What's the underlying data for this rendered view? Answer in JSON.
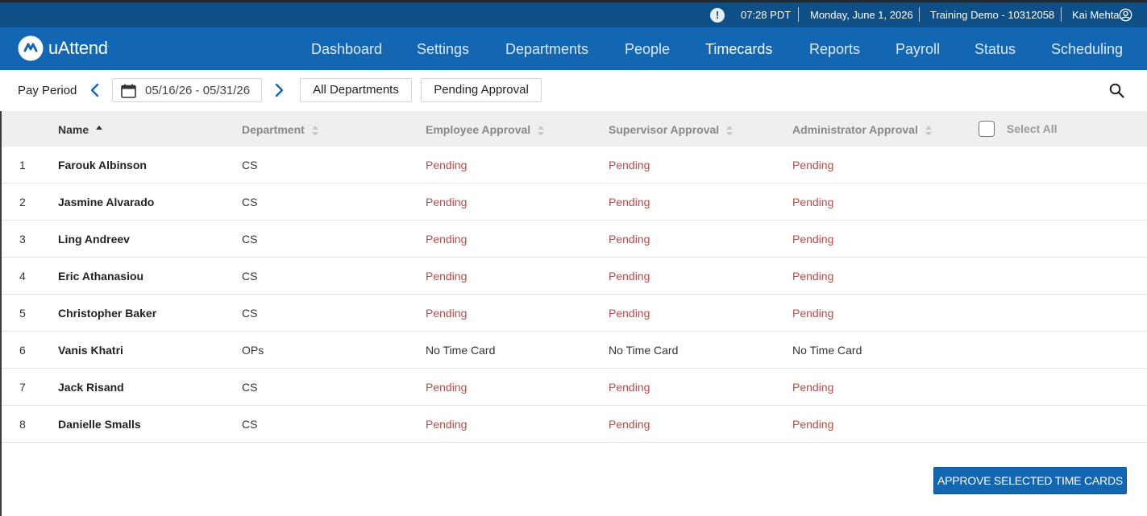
{
  "topbar": {
    "time": "07:28 PDT",
    "date": "Monday, June 1, 2026",
    "account": "Training Demo - 10312058",
    "user": "Kai Mehta",
    "alert_glyph": "!"
  },
  "brand": {
    "name": "uAttend",
    "trademark": "."
  },
  "nav": [
    {
      "label": "Dashboard"
    },
    {
      "label": "Settings"
    },
    {
      "label": "Departments"
    },
    {
      "label": "People"
    },
    {
      "label": "Timecards"
    },
    {
      "label": "Reports"
    },
    {
      "label": "Payroll"
    },
    {
      "label": "Status"
    },
    {
      "label": "Scheduling"
    }
  ],
  "active_nav": "Timecards",
  "toolbar": {
    "pay_period_label": "Pay Period",
    "date_range": "05/16/26 - 05/31/26",
    "department_filter": "All Departments",
    "status_filter": "Pending Approval"
  },
  "table": {
    "headers": {
      "name": "Name",
      "department": "Department",
      "employee_approval": "Employee Approval",
      "supervisor_approval": "Supervisor Approval",
      "administrator_approval": "Administrator Approval",
      "select_all": "Select All"
    },
    "rows": [
      {
        "num": "1",
        "name": "Farouk Albinson",
        "dept": "CS",
        "emp": "Pending",
        "sup": "Pending",
        "adm": "Pending"
      },
      {
        "num": "2",
        "name": "Jasmine Alvarado",
        "dept": "CS",
        "emp": "Pending",
        "sup": "Pending",
        "adm": "Pending"
      },
      {
        "num": "3",
        "name": "Ling Andreev",
        "dept": "CS",
        "emp": "Pending",
        "sup": "Pending",
        "adm": "Pending"
      },
      {
        "num": "4",
        "name": "Eric Athanasiou",
        "dept": "CS",
        "emp": "Pending",
        "sup": "Pending",
        "adm": "Pending"
      },
      {
        "num": "5",
        "name": "Christopher Baker",
        "dept": "CS",
        "emp": "Pending",
        "sup": "Pending",
        "adm": "Pending"
      },
      {
        "num": "6",
        "name": "Vanis Khatri",
        "dept": "OPs",
        "emp": "No Time Card",
        "sup": "No Time Card",
        "adm": "No Time Card"
      },
      {
        "num": "7",
        "name": "Jack Risand",
        "dept": "CS",
        "emp": "Pending",
        "sup": "Pending",
        "adm": "Pending"
      },
      {
        "num": "8",
        "name": "Danielle Smalls",
        "dept": "CS",
        "emp": "Pending",
        "sup": "Pending",
        "adm": "Pending"
      }
    ]
  },
  "approve_button": "APPROVE SELECTED TIME CARDS",
  "colors": {
    "topbar": "#0e4f88",
    "navbar": "#1366b1",
    "pending": "#b94a48",
    "accent": "#1366b1"
  },
  "icons": {
    "alert": "alert-icon",
    "user": "user-circle-icon",
    "logo": "uattend-logo-icon",
    "prev": "chevron-left-icon",
    "next": "chevron-right-icon",
    "calendar": "calendar-icon",
    "search": "search-icon",
    "sort_asc": "sort-asc-icon",
    "sort": "sort-icon",
    "checkbox": "checkbox-icon"
  }
}
